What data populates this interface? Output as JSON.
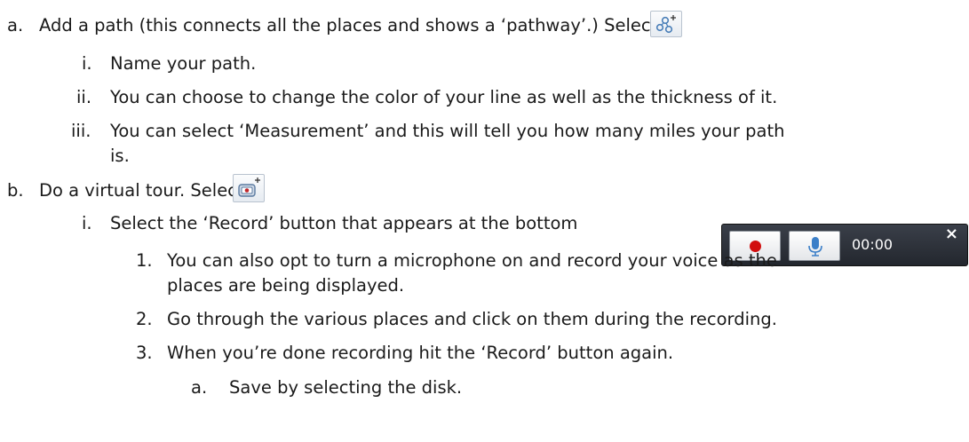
{
  "items": {
    "a": {
      "marker": "a.",
      "text": "Add a path (this connects all the places and shows a ‘pathway’.) Select",
      "icon": "add-path-icon",
      "sub": [
        {
          "marker": "i.",
          "text": "Name your path."
        },
        {
          "marker": "ii.",
          "text": "You can choose to change the color of your line as well as the thickness of it."
        },
        {
          "marker": "iii.",
          "text": "You can select ‘Measurement’ and this will tell you how many miles your path",
          "text_cont": "is."
        }
      ]
    },
    "b": {
      "marker": "b.",
      "text": "Do a virtual tour.  Select",
      "icon": "add-tour-icon",
      "sub": [
        {
          "marker": "i.",
          "text": "Select the ‘Record’ button that appears at the bottom",
          "steps": [
            {
              "marker": "1.",
              "text": "You can also opt to turn a microphone on and record your voice as the",
              "text_cont": "places are being displayed."
            },
            {
              "marker": "2.",
              "text": "Go through the various places and click on them during the recording."
            },
            {
              "marker": "3.",
              "text": "When you’re done recording hit the ‘Record’ button again.",
              "sub": [
                {
                  "marker": "a.",
                  "text": "Save by selecting the disk."
                }
              ]
            }
          ]
        }
      ]
    }
  },
  "record_bar": {
    "time": "00:00",
    "close": "×",
    "record_icon": "record-dot-icon",
    "mic_icon": "microphone-icon",
    "close_icon": "close-icon"
  },
  "colors": {
    "text": "#1a1a1a",
    "record_dot": "#d10e0e",
    "mic": "#3b7fc8",
    "bar_bg": "#2c3038"
  }
}
